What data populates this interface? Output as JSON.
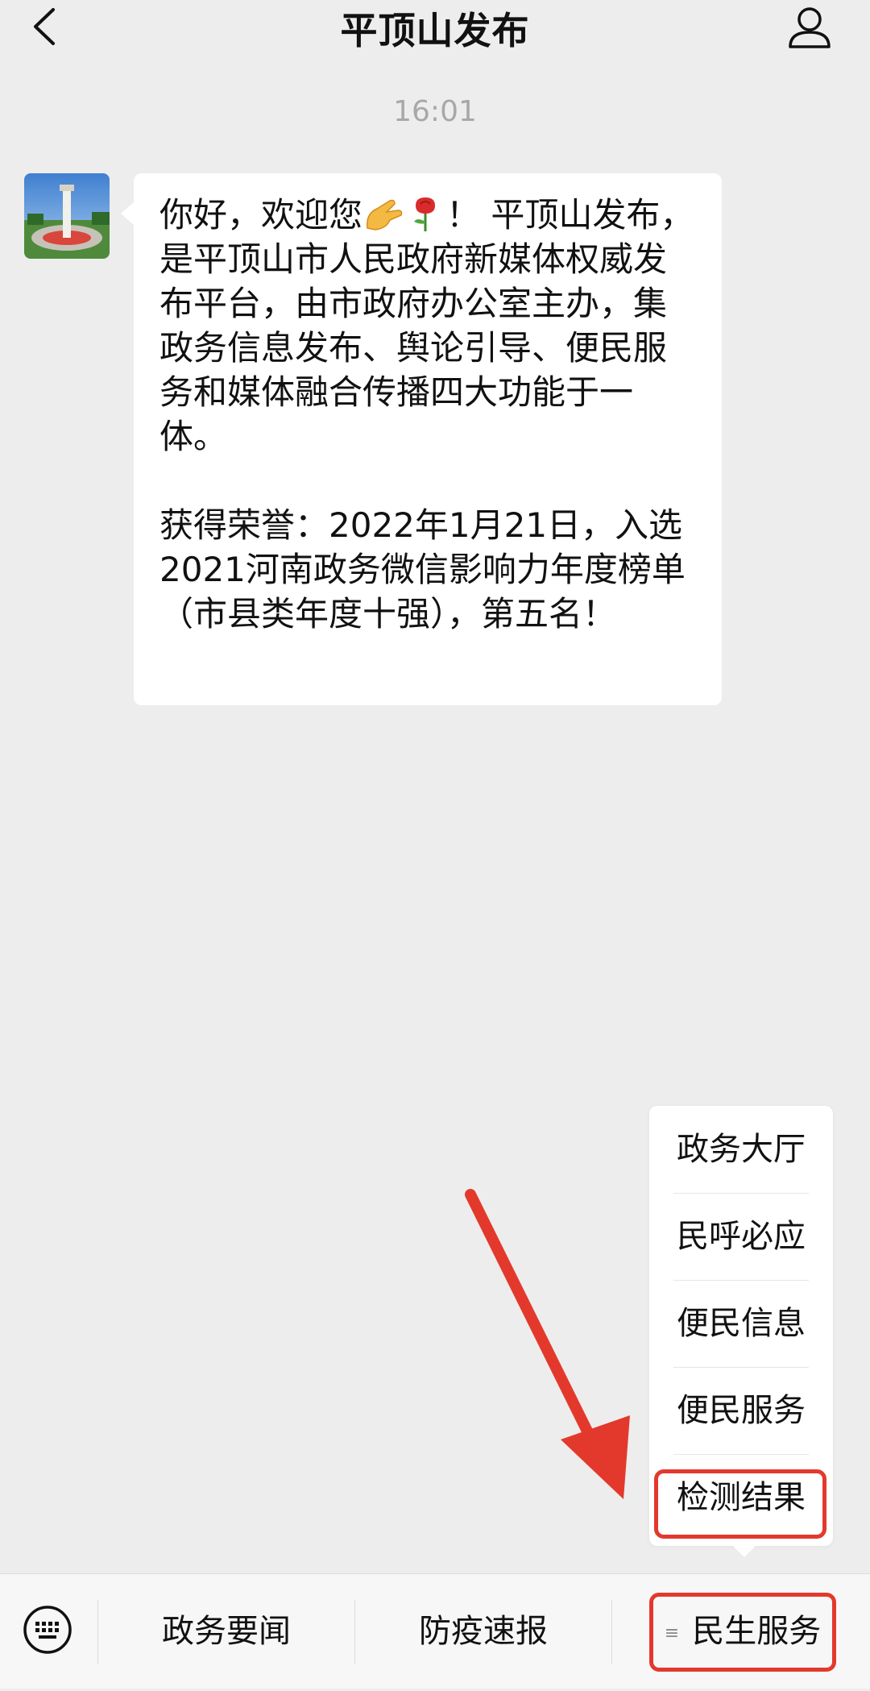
{
  "header": {
    "title": "平顶山发布"
  },
  "chat": {
    "time": "16:01",
    "message": {
      "para1_part1": "你好，欢迎您",
      "para1_part2": "！ 平顶山发布，是平顶山市人民政府新媒体权威发布平台，由市政府办公室主办，集政务信息发布、舆论引导、便民服务和媒体融合传播四大功能于一体。",
      "para2": "获得荣誉：2022年1月21日，入选2021河南政务微信影响力年度榜单（市县类年度十强），第五名！",
      "emojis": [
        "ok-hand-icon",
        "rose-icon"
      ]
    }
  },
  "submenu": {
    "items": [
      "政务大厅",
      "民呼必应",
      "便民信息",
      "便民服务",
      "检测结果"
    ],
    "highlighted": "检测结果"
  },
  "bottom_menu": {
    "tabs": [
      "政务要闻",
      "防疫速报",
      "民生服务"
    ],
    "active_tab": "民生服务",
    "active_tab_icon": "≡"
  },
  "annotation": {
    "color": "#e3392c"
  },
  "icons": [
    "back-icon",
    "profile-icon",
    "keyboard-icon",
    "menu-lines-icon"
  ]
}
